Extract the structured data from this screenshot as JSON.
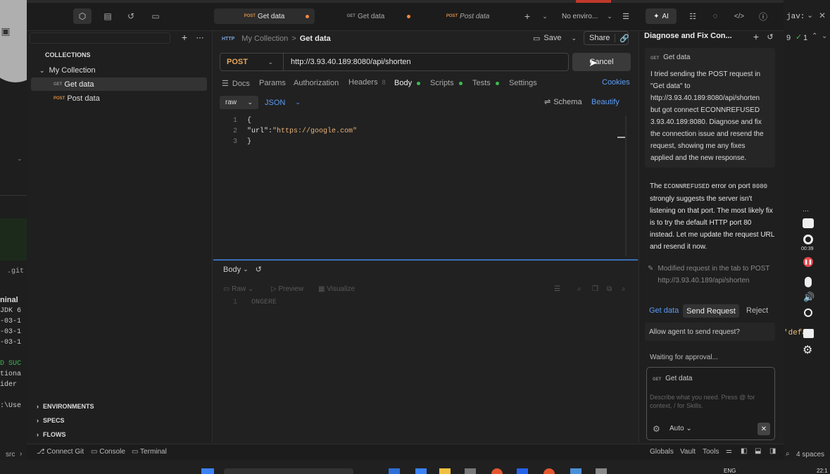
{
  "app": {
    "tabs": [
      {
        "method": "POST",
        "label": "Get data"
      },
      {
        "method": "GET",
        "label": "Get data"
      },
      {
        "method": "POST",
        "label": "Post data"
      }
    ],
    "env_label": "No enviro...",
    "ai_tab": "AI"
  },
  "sidebar": {
    "collections_header": "COLLECTIONS",
    "collection_name": "My Collection",
    "items": [
      {
        "method": "GET",
        "label": "Get data"
      },
      {
        "method": "POST",
        "label": "Post data"
      }
    ],
    "sections": [
      "ENVIRONMENTS",
      "SPECS",
      "FLOWS"
    ]
  },
  "breadcrumb": {
    "parent": "My Collection",
    "current": "Get data"
  },
  "toolbar": {
    "save": "Save",
    "share": "Share"
  },
  "request": {
    "method": "POST",
    "url": "http://3.93.40.189:8080/api/shorten",
    "cancel": "Cancel"
  },
  "request_tabs": {
    "docs": "Docs",
    "params": "Params",
    "authorization": "Authorization",
    "headers": "Headers",
    "headers_count": "8",
    "body": "Body",
    "scripts": "Scripts",
    "tests": "Tests",
    "settings": "Settings",
    "cookies": "Cookies"
  },
  "body_editor": {
    "mode": "raw",
    "format": "JSON",
    "schema": "Schema",
    "beautify": "Beautify",
    "lines": [
      {
        "num": "1",
        "text": "{"
      },
      {
        "num": "2",
        "key": "\"url\"",
        "colon": ":",
        "value": "\"https://google.com\""
      },
      {
        "num": "3",
        "text": "}"
      }
    ]
  },
  "response": {
    "label": "Body",
    "raw": "Raw",
    "preview": "Preview",
    "visualize": "Visualize",
    "line_num": "1",
    "line_text": "ONGERE"
  },
  "ai_panel": {
    "title": "Diagnose and Fix Con...",
    "context_method": "GET",
    "context_label": "Get data",
    "user_message": "I tried sending the POST request in \"Get data\" to http://3.93.40.189:8080/api/shorten but got connect ECONNREFUSED 3.93.40.189:8080. Diagnose and fix the connection issue and resend the request, showing me any fixes applied and the new response.",
    "reply_prefix": "The ",
    "reply_code1": "ECONNREFUSED",
    "reply_mid1": " error on port ",
    "reply_code2": "8080",
    "reply_rest": " strongly suggests the server isn't listening on that port. The most likely fix is to try the default HTTP port 80 instead. Let me update the request URL and resend it now.",
    "modified_note": "Modified request in the tab to POST http://3.93.40.189/api/shorten",
    "action_link": "Get data",
    "send_request": "Send Request",
    "reject": "Reject",
    "allow_prompt": "Allow agent to send request?",
    "waiting": "Waiting for approval...",
    "input_method": "GET",
    "input_label": "Get data",
    "input_placeholder": "Describe what you need. Press @ for context, / for Skills.",
    "mode": "Auto"
  },
  "statusbar": {
    "src": "src",
    "connect_git": "Connect Git",
    "console": "Console",
    "terminal": "Terminal",
    "globals": "Globals",
    "vault": "Vault",
    "tools": "Tools",
    "spaces": "4 spaces"
  },
  "background": {
    "terminal_label": "ninal",
    "terminal_lines": [
      "JDK 6",
      "-03-1",
      "-03-1",
      "-03-1",
      "",
      "D SUC",
      "tiona",
      "ider ",
      "",
      ":\\Use"
    ],
    "git_label": ".git",
    "right_text1": "jav:",
    "right_text2": "9",
    "right_text3": "1",
    "right_defa": "'defa",
    "rec_time": "00:39",
    "taskbar_lang": "ENG",
    "taskbar_time": "22:1"
  }
}
